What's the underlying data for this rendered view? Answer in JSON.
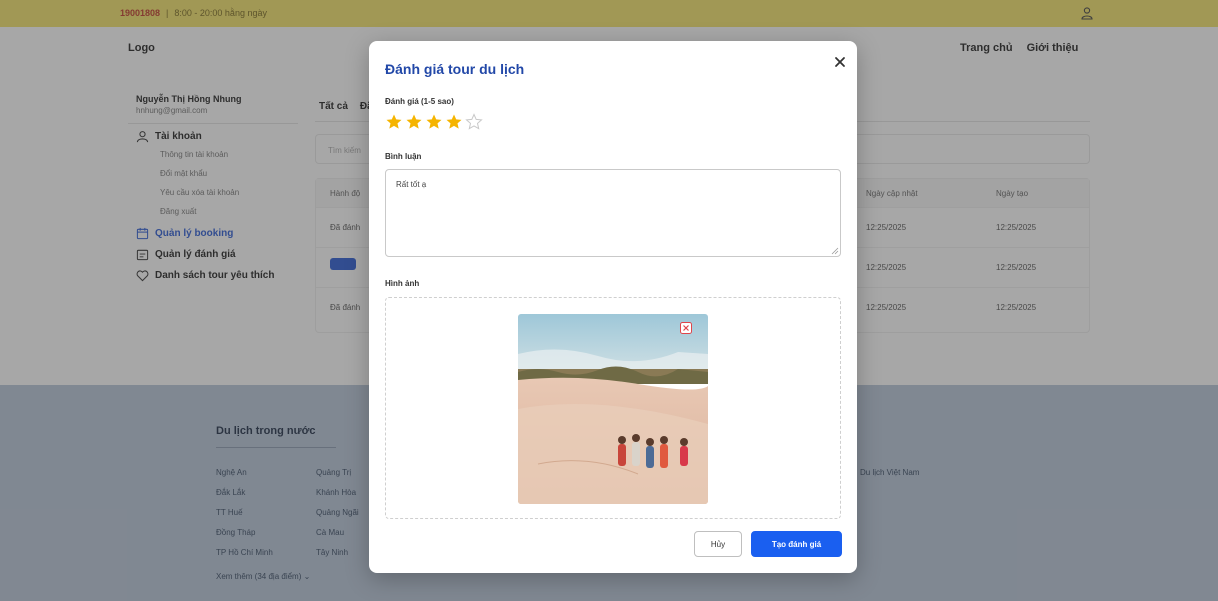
{
  "topbar": {
    "phone": "19001808",
    "hours": "8:00 - 20:00 hằng ngày"
  },
  "header": {
    "logo": "Logo",
    "nav": [
      "Trang chủ",
      "Giới thiệu"
    ]
  },
  "sidebar": {
    "user_name": "Nguyễn Thị Hồng Nhung",
    "user_email": "hnhung@gmail.com",
    "account_label": "Tài khoản",
    "account_items": [
      "Thông tin tài khoản",
      "Đổi mật khẩu",
      "Yêu cầu xóa tài khoản",
      "Đăng xuất"
    ],
    "booking_label": "Quản lý booking",
    "review_label": "Quản lý đánh giá",
    "favorites_label": "Danh sách tour yêu thích"
  },
  "content": {
    "tabs": [
      "Tất cả",
      "Đã"
    ],
    "search_placeholder": "Tìm kiếm",
    "table_headers": [
      "Hành độ",
      "Ngày cập nhật",
      "Ngày tạo"
    ],
    "rows": [
      {
        "name": "Đã đánh",
        "updated": "12:25/2025",
        "created": "12:25/2025"
      },
      {
        "name": "",
        "updated": "12:25/2025",
        "created": "12:25/2025"
      },
      {
        "name": "Đã đánh",
        "updated": "12:25/2025",
        "created": "12:25/2025"
      }
    ]
  },
  "footer": {
    "title": "Du lịch trong nước",
    "col1": [
      "Nghệ An",
      "Đắk Lắk",
      "TT Huế",
      "Đồng Tháp",
      "TP Hồ Chí Minh"
    ],
    "col2": [
      "Quảng Trị",
      "Khánh Hòa",
      "Quảng Ngãi",
      "Cà Mau",
      "Tây Ninh"
    ],
    "more": "Xem thêm (34 địa điểm)",
    "right_link": "Du lịch Việt Nam"
  },
  "modal": {
    "title": "Đánh giá tour du lịch",
    "rating_label": "Đánh giá (1-5 sao)",
    "rating": 4,
    "rating_max": 5,
    "comment_label": "Bình luận",
    "comment_value": "Rất tốt ạ",
    "image_label": "Hình ảnh",
    "cancel_label": "Hủy",
    "submit_label": "Tạo đánh giá"
  },
  "colors": {
    "topbar": "#f4e36a",
    "primary": "#1a5ff0",
    "title_blue": "#2248a8",
    "star": "#f5b400",
    "footer": "#b9c7d9"
  },
  "icons": {
    "close": "close-icon",
    "star": "star-icon",
    "remove_image": "remove-image-icon",
    "user": "user-icon"
  }
}
